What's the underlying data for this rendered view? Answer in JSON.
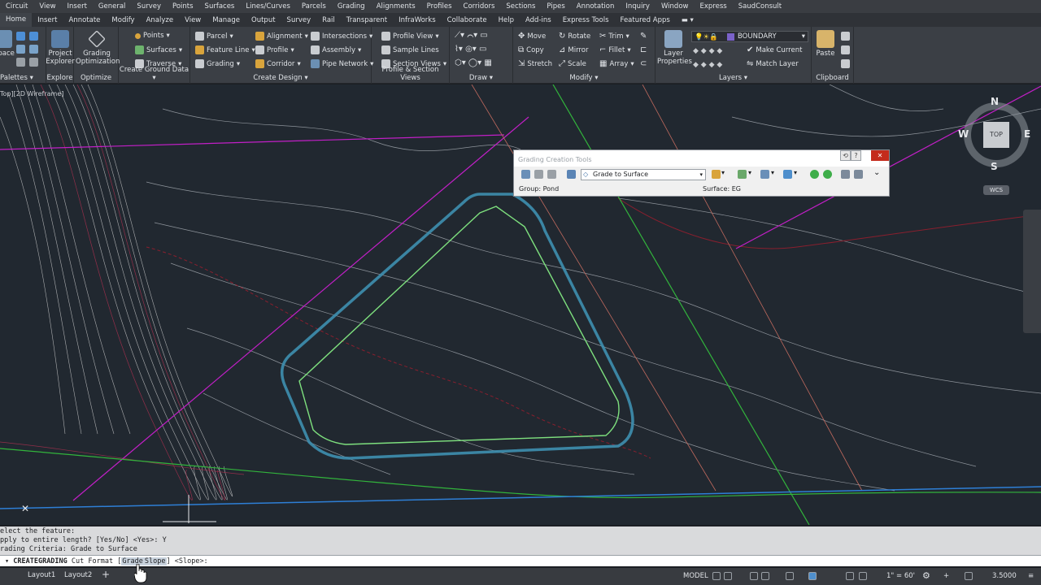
{
  "menubar": {
    "items": [
      "Circuit",
      "View",
      "Insert",
      "General",
      "Survey",
      "Points",
      "Surfaces",
      "Lines/Curves",
      "Parcels",
      "Grading",
      "Alignments",
      "Profiles",
      "Corridors",
      "Sections",
      "Pipes",
      "Annotation",
      "Inquiry",
      "Window",
      "Express",
      "SaudConsult"
    ]
  },
  "ribbon_tabs": {
    "items": [
      "Home",
      "Insert",
      "Annotate",
      "Modify",
      "Analyze",
      "View",
      "Manage",
      "Output",
      "Survey",
      "Rail",
      "Transparent",
      "InfraWorks",
      "Collaborate",
      "Help",
      "Add-ins",
      "Express Tools",
      "Featured Apps"
    ]
  },
  "ribbon": {
    "palettes": {
      "btn": "Space",
      "title": "Palettes"
    },
    "explore": {
      "btn1": "Project",
      "btn2": "Explorer",
      "title": "Explore"
    },
    "optimize": {
      "btn1": "Grading",
      "btn2": "Optimization",
      "title": "Optimize"
    },
    "ground": {
      "points": "Points",
      "surfaces": "Surfaces",
      "traverse": "Traverse",
      "title": "Create Ground Data"
    },
    "design": {
      "parcel": "Parcel",
      "feature_line": "Feature Line",
      "grading": "Grading",
      "alignment": "Alignment",
      "profile": "Profile",
      "corridor": "Corridor",
      "intersections": "Intersections",
      "assembly": "Assembly",
      "pipe_network": "Pipe Network",
      "title": "Create Design"
    },
    "profile_section": {
      "profile_view": "Profile View",
      "sample_lines": "Sample Lines",
      "section_views": "Section Views",
      "title": "Profile & Section Views"
    },
    "draw": {
      "title": "Draw"
    },
    "modify": {
      "move": "Move",
      "copy": "Copy",
      "stretch": "Stretch",
      "rotate": "Rotate",
      "mirror": "Mirror",
      "scale": "Scale",
      "trim": "Trim",
      "fillet": "Fillet",
      "array": "Array",
      "title": "Modify"
    },
    "layers": {
      "btn1": "Layer",
      "btn2": "Properties",
      "current_layer": "BOUNDARY",
      "make_current": "Make Current",
      "match_layer": "Match Layer",
      "title": "Layers"
    },
    "clipboard": {
      "paste": "Paste",
      "title": "Clipboard"
    }
  },
  "viewport": {
    "label": "Top][2D Wireframe]"
  },
  "viewcube": {
    "top": "TOP",
    "n": "N",
    "s": "S",
    "e": "E",
    "w": "W",
    "wcs": "WCS"
  },
  "grading_tools": {
    "title": "Grading Creation Tools",
    "criteria": "Grade to Surface",
    "group": "Group: Pond",
    "surface": "Surface: EG"
  },
  "command": {
    "history": [
      "elect the feature:",
      "pply to entire length? [Yes/No] <Yes>: Y",
      "rading Criteria:  Grade to Surface"
    ],
    "name": "CREATEGRADING",
    "text_before": " Cut Format [",
    "opt1": "Grade",
    "opt2": "Slope",
    "text_after": "] <Slope>:"
  },
  "statusbar": {
    "tab1": "Layout1",
    "tab2": "Layout2",
    "add": "+",
    "model": "MODEL",
    "scale": "1\" = 60'",
    "value": "3.5000"
  },
  "colors": {
    "canvas": "#212830",
    "pond_outline": "#3e8fb0",
    "feature_line": "#7ee07e",
    "magenta": "#c21fc7",
    "boundary_blue": "#2e7fd6"
  }
}
